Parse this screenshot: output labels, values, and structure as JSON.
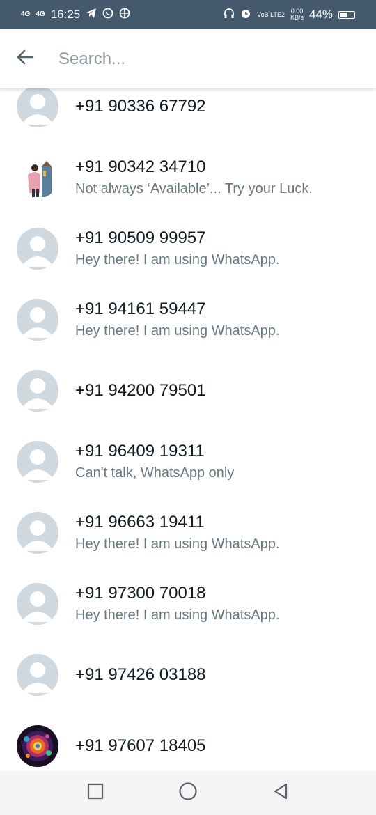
{
  "status_bar": {
    "network1": "4G",
    "network2": "4G",
    "time": "16:25",
    "volte": "VoB LTE2",
    "speed_value": "0.00",
    "speed_unit": "KB/s",
    "battery": "44%",
    "battery_level": 0.44
  },
  "search": {
    "placeholder": "Search..."
  },
  "contacts": [
    {
      "name": "+91 90336 67792",
      "status": "",
      "avatar": "default"
    },
    {
      "name": "+91 90342 34710",
      "status": "Not always ‘Available’... Try your Luck.",
      "avatar": "photo-person"
    },
    {
      "name": "+91 90509 99957",
      "status": "Hey there! I am using WhatsApp.",
      "avatar": "default"
    },
    {
      "name": "+91 94161 59447",
      "status": "Hey there! I am using WhatsApp.",
      "avatar": "default"
    },
    {
      "name": "+91 94200 79501",
      "status": "",
      "avatar": "default"
    },
    {
      "name": "+91 96409 19311",
      "status": "Can't talk, WhatsApp only",
      "avatar": "default"
    },
    {
      "name": "+91 96663 19411",
      "status": "Hey there! I am using WhatsApp.",
      "avatar": "default"
    },
    {
      "name": "+91 97300 70018",
      "status": "Hey there! I am using WhatsApp.",
      "avatar": "default"
    },
    {
      "name": "+91 97426 03188",
      "status": "",
      "avatar": "default"
    },
    {
      "name": "+91 97607 18405",
      "status": "",
      "avatar": "photo-fractal"
    }
  ],
  "icons": {
    "back": "arrow-left-icon",
    "nav_recents": "square-icon",
    "nav_home": "circle-icon",
    "nav_back": "triangle-back-icon"
  },
  "colors": {
    "status_bar_bg": "#44596b",
    "avatar_bg": "#cfd8de",
    "avatar_fg": "#ffffff",
    "name_text": "#111b21",
    "status_text": "#667781"
  }
}
